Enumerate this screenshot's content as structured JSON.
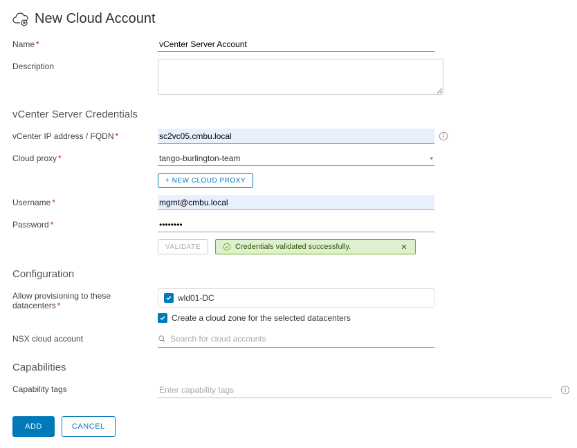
{
  "header": {
    "title": "New Cloud Account"
  },
  "fields": {
    "name_label": "Name",
    "name_value": "vCenter Server Account",
    "description_label": "Description",
    "description_value": ""
  },
  "credentials": {
    "section_title": "vCenter Server Credentials",
    "ip_label": "vCenter IP address / FQDN",
    "ip_value": "sc2vc05.cmbu.local",
    "proxy_label": "Cloud proxy",
    "proxy_value": "tango-burlington-team",
    "new_proxy_button": "+ NEW CLOUD PROXY",
    "username_label": "Username",
    "username_value": "mgmt@cmbu.local",
    "password_label": "Password",
    "password_value": "••••••••",
    "validate_button": "VALIDATE",
    "validate_success": "Credentials validated successfully."
  },
  "configuration": {
    "section_title": "Configuration",
    "allow_label": "Allow provisioning to these datacenters",
    "datacenter_checked": true,
    "datacenter_name": "wld01-DC",
    "create_zone_label": "Create a cloud zone for the selected datacenters",
    "nsx_label": "NSX cloud account",
    "nsx_placeholder": "Search for cloud accounts"
  },
  "capabilities": {
    "section_title": "Capabilities",
    "tags_label": "Capability tags",
    "tags_placeholder": "Enter capability tags"
  },
  "footer": {
    "add_button": "ADD",
    "cancel_button": "CANCEL"
  }
}
